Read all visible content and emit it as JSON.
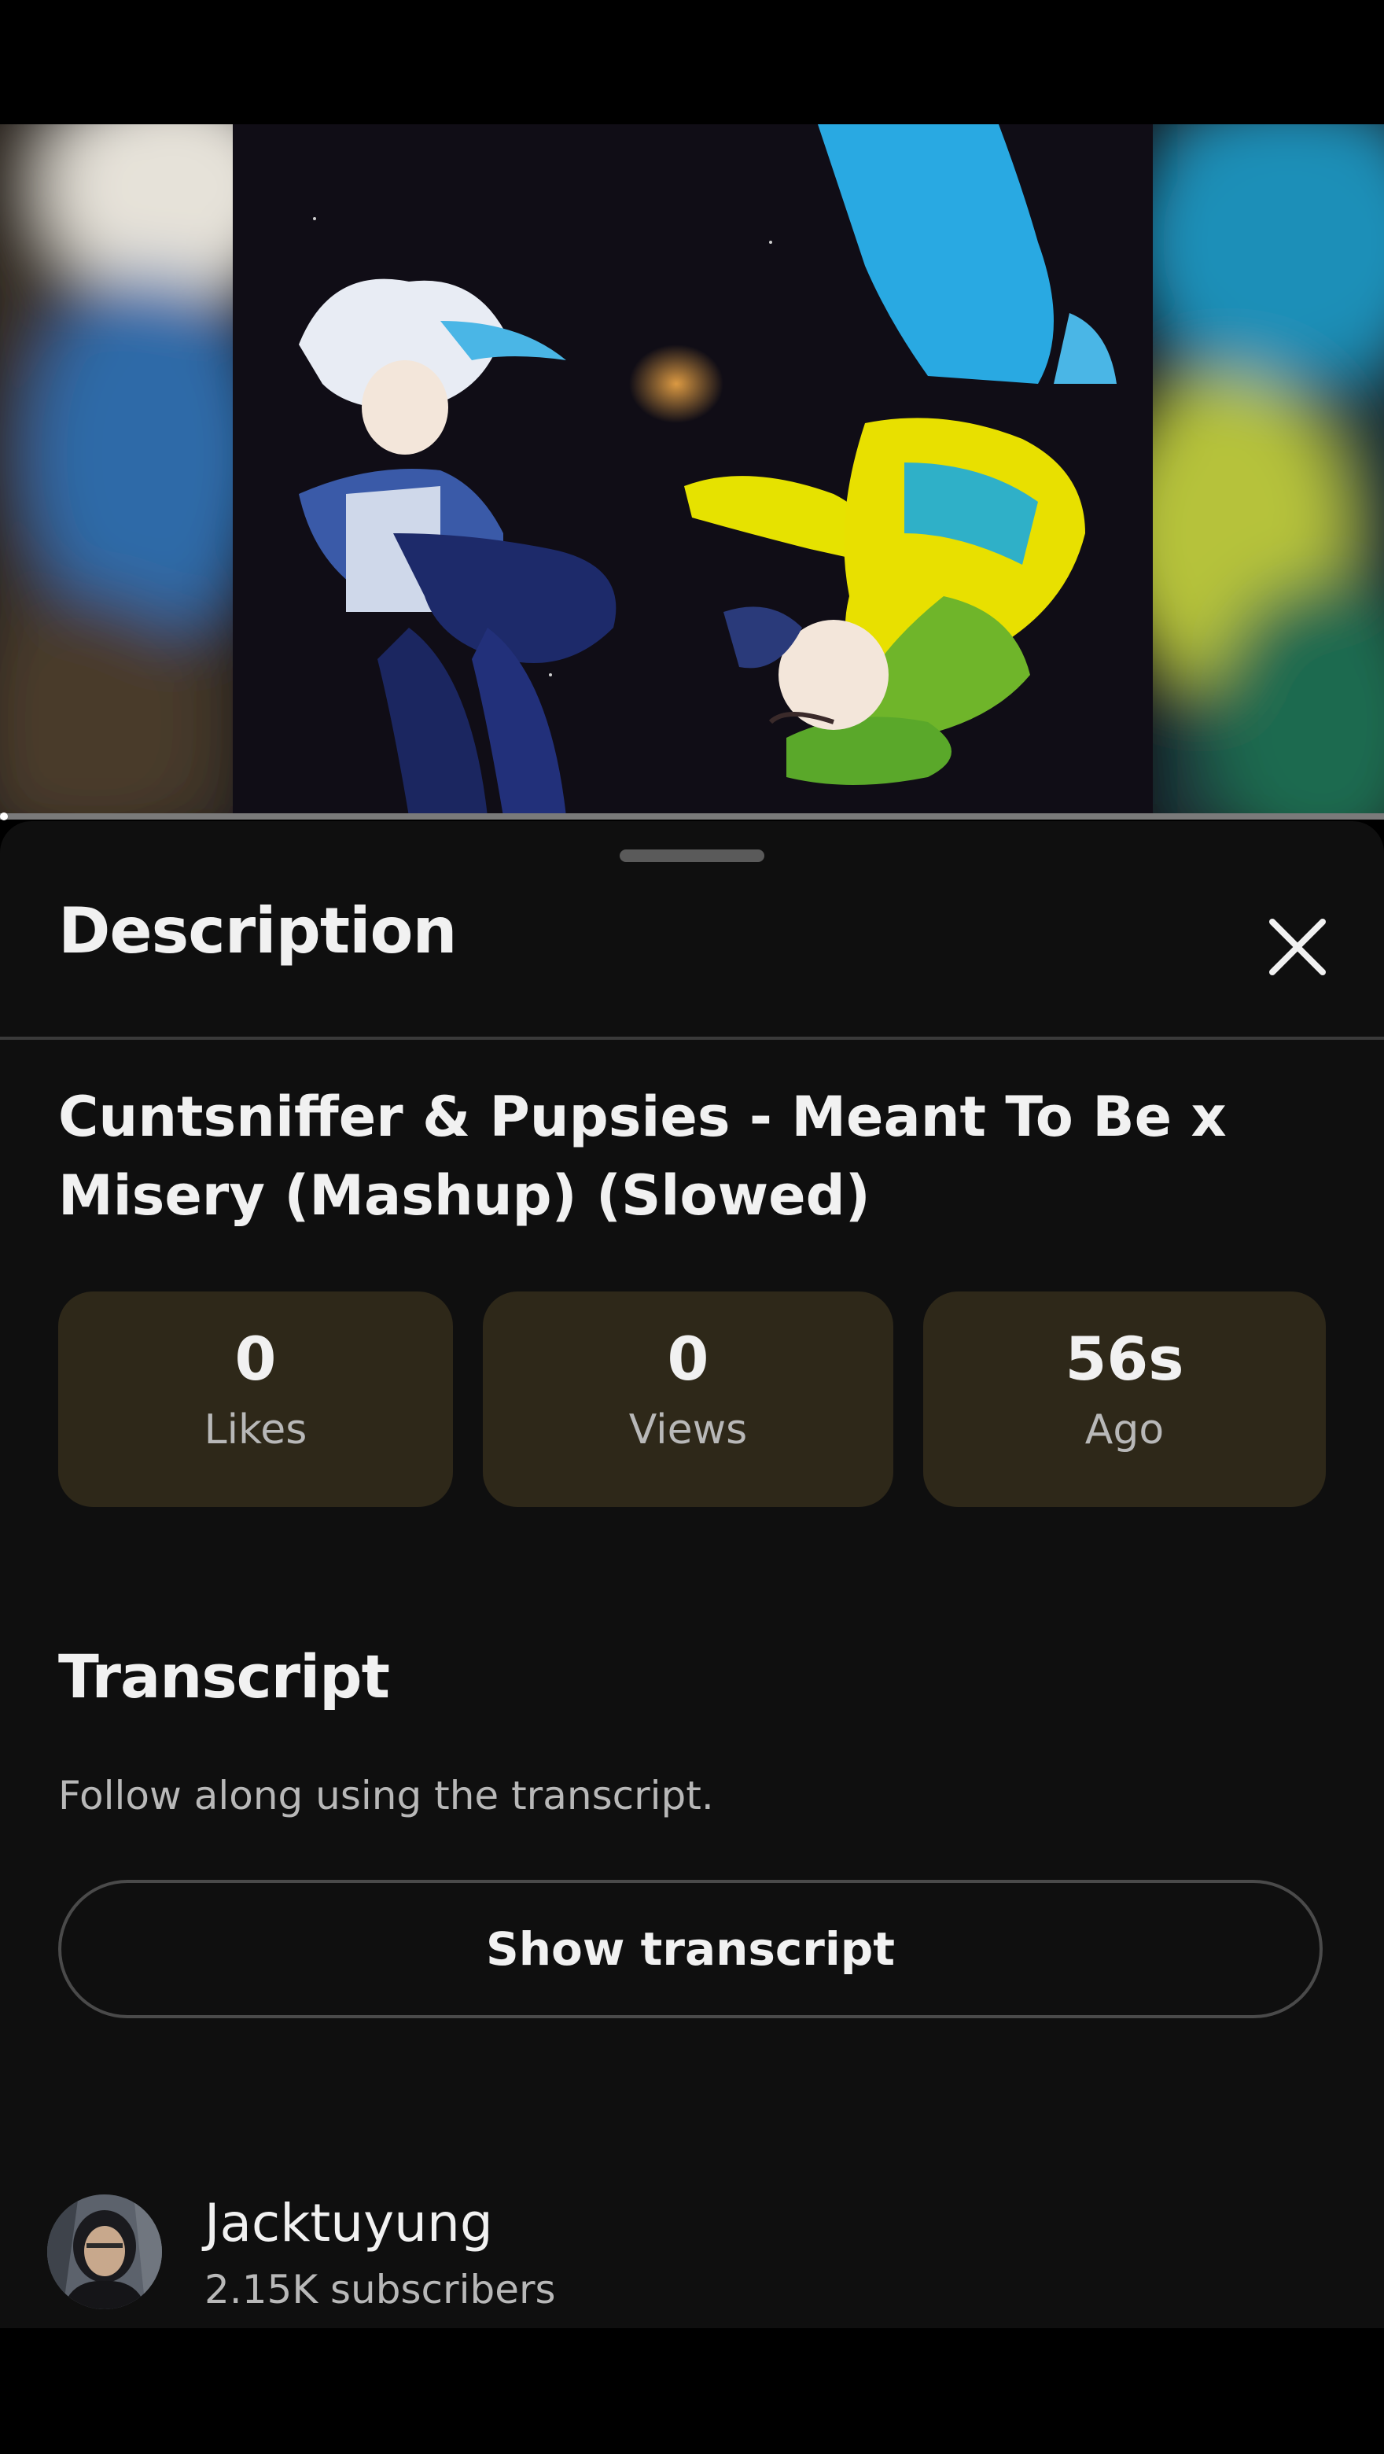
{
  "video": {
    "thumbnail_icon": "anime-artwork-thumbnail",
    "progress_fraction": 0.0
  },
  "description_sheet": {
    "title": "Description",
    "close_icon": "close-icon"
  },
  "video_info": {
    "title": "Cuntsniffer & Pupsies - Meant To Be x Misery (Mashup) (Slowed)",
    "stats": [
      {
        "value": "0",
        "label": "Likes"
      },
      {
        "value": "0",
        "label": "Views"
      },
      {
        "value": "56s",
        "label": "Ago"
      }
    ],
    "stat_card_color": "#2e2819"
  },
  "transcript": {
    "heading": "Transcript",
    "subtitle": "Follow along using the transcript.",
    "button_label": "Show transcript"
  },
  "channel": {
    "name": "Jacktuyung",
    "subscribers": "2.15K subscribers",
    "avatar_icon": "avatar"
  }
}
